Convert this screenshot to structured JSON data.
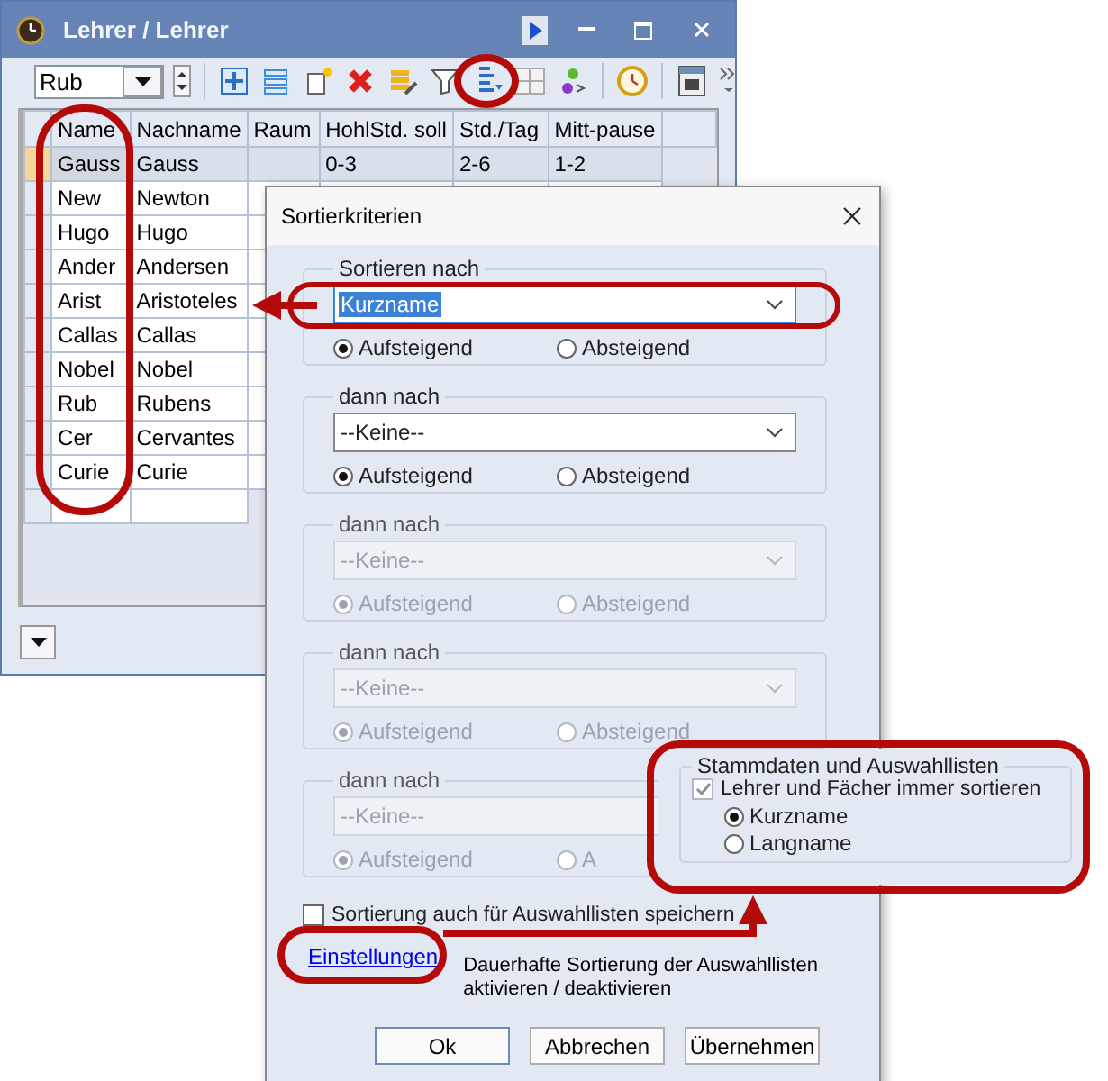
{
  "main_window": {
    "title": "Lehrer / Lehrer",
    "record_combo": "Rub",
    "table": {
      "columns": [
        "Name",
        "Nachname",
        "Raum",
        "HohlStd. soll",
        "Std./Tag",
        "Mitt-pause"
      ],
      "rows": [
        {
          "name": "Gauss",
          "nachname": "Gauss",
          "hohlstd": "0-3",
          "std_tag": "2-6",
          "mitt_pause": "1-2",
          "selected": true
        },
        {
          "name": "New",
          "nachname": "Newton",
          "selected": false
        },
        {
          "name": "Hugo",
          "nachname": "Hugo",
          "selected": false
        },
        {
          "name": "Ander",
          "nachname": "Andersen",
          "selected": false
        },
        {
          "name": "Arist",
          "nachname": "Aristoteles",
          "selected": false
        },
        {
          "name": "Callas",
          "nachname": "Callas",
          "selected": false
        },
        {
          "name": "Nobel",
          "nachname": "Nobel",
          "selected": false
        },
        {
          "name": "Rub",
          "nachname": "Rubens",
          "selected": false
        },
        {
          "name": "Cer",
          "nachname": "Cervantes",
          "selected": false
        },
        {
          "name": "Curie",
          "nachname": "Curie",
          "selected": false
        }
      ]
    }
  },
  "dialog": {
    "title": "Sortierkriterien",
    "groups": [
      {
        "label": "Sortieren nach",
        "value": "Kurzname",
        "focused": true,
        "disabled": false,
        "options": [
          {
            "label": "Aufsteigend",
            "selected": true
          },
          {
            "label": "Absteigend",
            "selected": false
          }
        ]
      },
      {
        "label": "dann nach",
        "value": "--Keine--",
        "focused": false,
        "disabled": false,
        "options": [
          {
            "label": "Aufsteigend",
            "selected": true
          },
          {
            "label": "Absteigend",
            "selected": false
          }
        ]
      },
      {
        "label": "dann nach",
        "value": "--Keine--",
        "focused": false,
        "disabled": true,
        "options": [
          {
            "label": "Aufsteigend",
            "selected": true
          },
          {
            "label": "Absteigend",
            "selected": false
          }
        ]
      },
      {
        "label": "dann nach",
        "value": "--Keine--",
        "focused": false,
        "disabled": true,
        "options": [
          {
            "label": "Aufsteigend",
            "selected": true
          },
          {
            "label": "Absteigend",
            "selected": false
          }
        ]
      },
      {
        "label": "dann nach",
        "value": "--Keine--",
        "focused": false,
        "disabled": true,
        "options": [
          {
            "label": "Aufsteigend",
            "selected": true
          },
          {
            "label": "A",
            "selected": false
          }
        ]
      }
    ],
    "save_checkbox": {
      "label": "Sortierung auch für Auswahllisten speichern",
      "checked": false
    },
    "link": "Einstellungen",
    "link_description": "Dauerhafte Sortierung der Auswahllisten aktivieren / deaktivieren",
    "buttons": [
      "Ok",
      "Abbrechen",
      "Übernehmen"
    ]
  },
  "callout": {
    "title": "Stammdaten und Auswahllisten",
    "checkbox": {
      "label": "Lehrer und Fächer immer sortieren",
      "checked": true,
      "disabled": true
    },
    "options": [
      {
        "label": "Kurzname",
        "selected": true
      },
      {
        "label": "Langname",
        "selected": false
      }
    ]
  }
}
